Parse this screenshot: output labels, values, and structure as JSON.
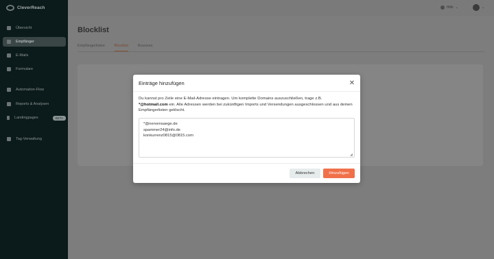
{
  "app": {
    "name": "CleverReach"
  },
  "sidebar": {
    "items": [
      {
        "label": "Übersicht"
      },
      {
        "label": "Empfänger"
      },
      {
        "label": "E-Mails"
      },
      {
        "label": "Formulare"
      },
      {
        "label": "Automation-Flow"
      },
      {
        "label": "Reports & Analysen"
      },
      {
        "label": "Landingpages",
        "badge": "BETA"
      },
      {
        "label": "Tag-Verwaltung"
      }
    ]
  },
  "header": {
    "language": "Hilfe",
    "lang_chevron": "⌄",
    "user_chevron": "⌄"
  },
  "page": {
    "title": "Blocklist",
    "tabs": [
      {
        "label": "Empfängerlisten"
      },
      {
        "label": "Blocklist"
      },
      {
        "label": "Bounces"
      }
    ]
  },
  "modal": {
    "title": "Einträge hinzufügen",
    "close_glyph": "✕",
    "desc_part1": "Du kannst pro Zeile eine E-Mail-Adresse eintragen. Um komplette Domains auszuschließen, trage z.B.",
    "desc_bold": "*@hotmail.com",
    "desc_part2": " ein. Alle Adressen werden bei zukünftigen Imports und Versendungen ausgeschlossen und aus deinen Empfängerlisten gelöscht.",
    "textarea_value": "*@nervensaege.de\nspammer24@info.de\nkonkurrenz0815@0815.com",
    "resize_glyph": "◢",
    "cancel_label": "Abbrechen",
    "submit_label": "Hinzufügen"
  },
  "colors": {
    "accent": "#f0704a",
    "sidebar_bg": "#0b1a1a",
    "overlay": "#7d7d7d"
  }
}
